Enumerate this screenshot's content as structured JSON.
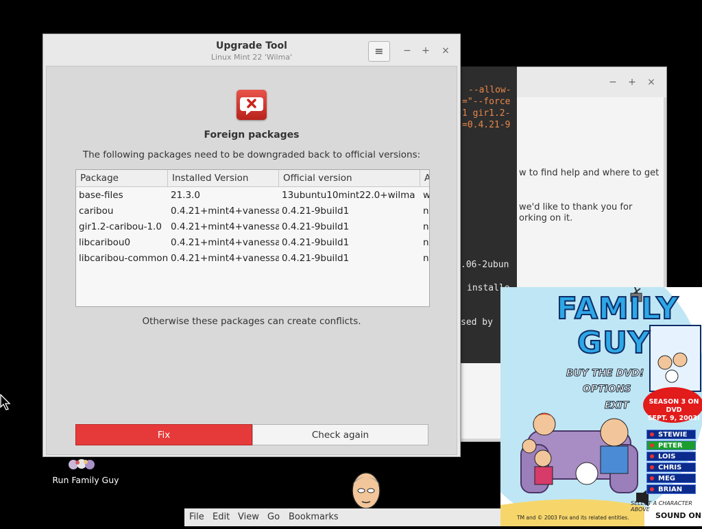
{
  "main_window": {
    "title": "Upgrade Tool",
    "subtitle": "Linux Mint 22 'Wilma'",
    "menu_glyph": "≡",
    "minimize": "−",
    "maximize": "+",
    "close": "×",
    "icon": "alert-bubble-icon",
    "heading": "Foreign packages",
    "description": "The following packages need to be downgraded back to official versions:",
    "table": {
      "columns": [
        "Package",
        "Installed Version",
        "Official version",
        "A"
      ],
      "rows": [
        [
          "base-files",
          "21.3.0",
          "13ubuntu10mint22.0+wilma",
          "w"
        ],
        [
          "caribou",
          "0.4.21+mint4+vanessa",
          "0.4.21-9build1",
          "n"
        ],
        [
          "gir1.2-caribou-1.0",
          "0.4.21+mint4+vanessa",
          "0.4.21-9build1",
          "n"
        ],
        [
          "libcaribou0",
          "0.4.21+mint4+vanessa",
          "0.4.21-9build1",
          "n"
        ],
        [
          "libcaribou-common",
          "0.4.21+mint4+vanessa",
          "0.4.21-9build1",
          "n"
        ]
      ]
    },
    "footer_note": "Otherwise these packages can create conflicts.",
    "fix_label": "Fix",
    "check_label": "Check again"
  },
  "bg_window": {
    "minimize": "−",
    "maximize": "+",
    "close": "×",
    "term_lines": [
      "--allow-",
      "=\"--force",
      "1 gir1.2-",
      "=0.4.21-9"
    ],
    "term_white": [
      ".06-2ubun",
      "installe",
      "sed by"
    ],
    "text_lines": [
      "w to find help and where to get",
      "we'd like to thank you for",
      "orking on it."
    ]
  },
  "desktop": {
    "icon_label": "Run Family Guy"
  },
  "file_manager_menu": [
    "File",
    "Edit",
    "View",
    "Go",
    "Bookmarks"
  ],
  "promo": {
    "title_top": "FAMILY",
    "title_bottom": "GUY",
    "menu": [
      "BUY THE DVD!",
      "OPTIONS",
      "EXIT"
    ],
    "season_line1": "SEASON 3 ON DVD",
    "season_line2": "SEPT. 9, 2003!",
    "characters": [
      "STEWIE",
      "PETER",
      "LOIS",
      "CHRIS",
      "MEG",
      "BRIAN"
    ],
    "select_hint": "SELECT A CHARACTER ABOVE",
    "copyright": "TM and © 2003 Fox and its related entities.",
    "sound_label": "SOUND ON",
    "colors": {
      "sky": "#bfe6f5",
      "title_fill": "#2ea7e6",
      "banner": "#e21b1b",
      "button": "#0b2c8c"
    }
  }
}
